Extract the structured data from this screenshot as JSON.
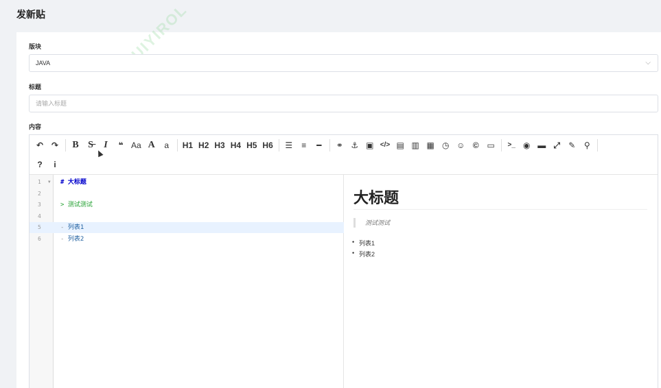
{
  "page": {
    "title": "发新贴"
  },
  "watermark": "CUIYIROL",
  "form": {
    "section_label": "版块",
    "section_value": "JAVA",
    "title_label": "标题",
    "title_placeholder": "请输入标题",
    "content_label": "内容"
  },
  "toolbar": {
    "row1": [
      {
        "name": "undo-icon",
        "glyph": "↶"
      },
      {
        "name": "redo-icon",
        "glyph": "↷"
      },
      {
        "sep": true
      },
      {
        "name": "bold-icon",
        "glyph": "B",
        "serif": true
      },
      {
        "name": "strikethrough-icon",
        "glyph": "S̶",
        "serif": true
      },
      {
        "name": "italic-icon",
        "glyph": "I",
        "serif": true,
        "italic": true
      },
      {
        "name": "quote-icon",
        "glyph": "❝"
      },
      {
        "name": "uppercase-icon",
        "glyph": "Aa",
        "thin": true
      },
      {
        "name": "uppercase-first-icon",
        "glyph": "A",
        "serif": true
      },
      {
        "name": "lowercase-icon",
        "glyph": "a",
        "thin": true
      },
      {
        "sep": true
      },
      {
        "name": "h1-button",
        "glyph": "H1",
        "h": true
      },
      {
        "name": "h2-button",
        "glyph": "H2",
        "h": true
      },
      {
        "name": "h3-button",
        "glyph": "H3",
        "h": true
      },
      {
        "name": "h4-button",
        "glyph": "H4",
        "h": true
      },
      {
        "name": "h5-button",
        "glyph": "H5",
        "h": true
      },
      {
        "name": "h6-button",
        "glyph": "H6",
        "h": true
      },
      {
        "sep": true
      },
      {
        "name": "unordered-list-icon",
        "glyph": "☰"
      },
      {
        "name": "ordered-list-icon",
        "glyph": "≡"
      },
      {
        "name": "horizontal-rule-icon",
        "glyph": "━"
      },
      {
        "sep": true
      },
      {
        "name": "link-icon",
        "glyph": "⚭"
      },
      {
        "name": "anchor-icon",
        "glyph": "⚓"
      },
      {
        "name": "image-icon",
        "glyph": "▣"
      },
      {
        "name": "code-inline-icon",
        "glyph": "</>",
        "small": true
      },
      {
        "name": "code-block-icon",
        "glyph": "▤",
        "thin": true
      },
      {
        "name": "code-preformatted-icon",
        "glyph": "▥",
        "thin": true
      },
      {
        "name": "table-icon",
        "glyph": "▦"
      },
      {
        "name": "datetime-icon",
        "glyph": "◷"
      },
      {
        "name": "emoji-icon",
        "glyph": "☺"
      },
      {
        "name": "html-entities-icon",
        "glyph": "©"
      },
      {
        "name": "pagebreak-icon",
        "glyph": "▭"
      },
      {
        "sep": true
      },
      {
        "name": "goto-line-icon",
        "glyph": ">_",
        "small": true
      },
      {
        "name": "toggle-watch-icon",
        "glyph": "◉"
      },
      {
        "name": "preview-icon",
        "glyph": "▬"
      },
      {
        "name": "fullscreen-icon",
        "glyph": "⤢"
      },
      {
        "name": "clear-icon",
        "glyph": "✎"
      },
      {
        "name": "search-icon",
        "glyph": "⚲"
      },
      {
        "sep": true
      }
    ],
    "row2": [
      {
        "name": "help-icon",
        "glyph": "?"
      },
      {
        "name": "info-icon",
        "glyph": "i"
      }
    ]
  },
  "code": {
    "lines": [
      {
        "num": "1",
        "fold": "▼",
        "prefix": "#",
        "text": "大标题",
        "kind": "head"
      },
      {
        "num": "2",
        "fold": "",
        "prefix": "",
        "text": "",
        "kind": "plain"
      },
      {
        "num": "3",
        "fold": "",
        "prefix": ">",
        "text": "测试测试",
        "kind": "quote"
      },
      {
        "num": "4",
        "fold": "",
        "prefix": "",
        "text": "",
        "kind": "plain"
      },
      {
        "num": "5",
        "fold": "",
        "prefix": "-",
        "text": "列表1",
        "kind": "list",
        "active": true
      },
      {
        "num": "6",
        "fold": "",
        "prefix": "-",
        "text": "列表2",
        "kind": "list"
      }
    ]
  },
  "preview": {
    "heading": "大标题",
    "quote": "测试测试",
    "items": [
      "列表1",
      "列表2"
    ]
  }
}
